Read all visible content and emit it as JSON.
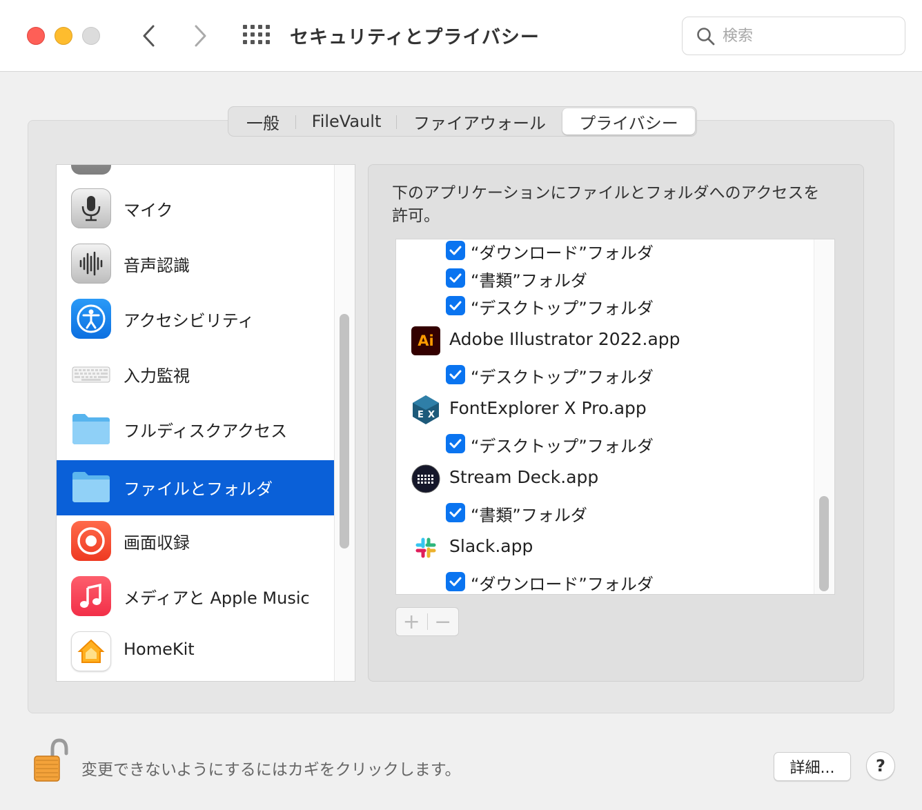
{
  "window": {
    "title": "セキュリティとプライバシー",
    "search_placeholder": "検索"
  },
  "tabs": [
    {
      "label": "一般",
      "selected": false
    },
    {
      "label": "FileVault",
      "selected": false
    },
    {
      "label": "ファイアウォール",
      "selected": false
    },
    {
      "label": "プライバシー",
      "selected": true
    }
  ],
  "sidebar": {
    "items": [
      {
        "label": "マイク",
        "icon": "microphone-icon"
      },
      {
        "label": "音声認識",
        "icon": "speech-recognition-icon"
      },
      {
        "label": "アクセシビリティ",
        "icon": "accessibility-icon"
      },
      {
        "label": "入力監視",
        "icon": "keyboard-icon"
      },
      {
        "label": "フルディスクアクセス",
        "icon": "folder-icon"
      },
      {
        "label": "ファイルとフォルダ",
        "icon": "folder-icon",
        "selected": true
      },
      {
        "label": "画面収録",
        "icon": "screen-recording-icon"
      },
      {
        "label": "メディアと Apple Music",
        "icon": "music-icon"
      },
      {
        "label": "HomeKit",
        "icon": "homekit-icon"
      }
    ]
  },
  "main": {
    "description": "下のアプリケーションにファイルとフォルダへのアクセスを許可。",
    "entries": [
      {
        "type": "folder",
        "label": "“ダウンロード”フォルダ",
        "checked": true
      },
      {
        "type": "folder",
        "label": "“書類”フォルダ",
        "checked": true
      },
      {
        "type": "folder",
        "label": "“デスクトップ”フォルダ",
        "checked": true
      },
      {
        "type": "app",
        "label": "Adobe Illustrator 2022.app",
        "icon": "adobe-illustrator-icon",
        "icon_text": "Ai"
      },
      {
        "type": "folder",
        "label": "“デスクトップ”フォルダ",
        "checked": true
      },
      {
        "type": "app",
        "label": "FontExplorer X Pro.app",
        "icon": "fontexplorer-icon"
      },
      {
        "type": "folder",
        "label": "“デスクトップ”フォルダ",
        "checked": true
      },
      {
        "type": "app",
        "label": "Stream Deck.app",
        "icon": "stream-deck-icon"
      },
      {
        "type": "folder",
        "label": "“書類”フォルダ",
        "checked": true
      },
      {
        "type": "app",
        "label": "Slack.app",
        "icon": "slack-icon"
      },
      {
        "type": "folder",
        "label": "“ダウンロード”フォルダ",
        "checked": true
      }
    ],
    "add_label": "+",
    "remove_label": "−"
  },
  "footer": {
    "lock_text": "変更できないようにするにはカギをクリックします。",
    "advanced_label": "詳細...",
    "help_label": "?"
  },
  "colors": {
    "selection": "#0a60d8",
    "checkbox": "#0a74f0"
  }
}
